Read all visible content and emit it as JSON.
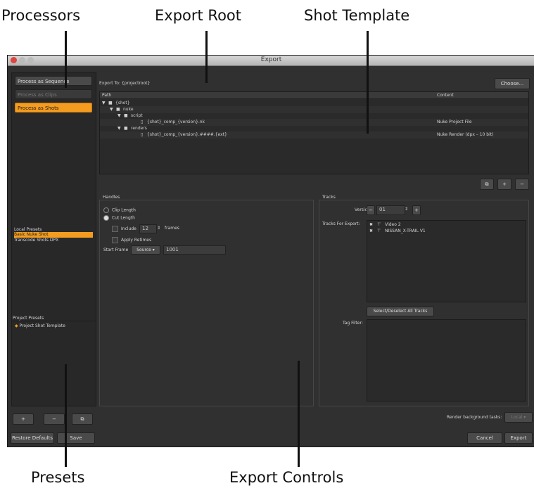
{
  "callouts": {
    "processors": "Processors",
    "export_root": "Export Root",
    "shot_template": "Shot Template",
    "presets": "Presets",
    "export_controls": "Export Controls"
  },
  "window": {
    "title": "Export"
  },
  "processors": {
    "items": [
      {
        "label": "Process as Sequence",
        "state": "normal"
      },
      {
        "label": "Process as Clips",
        "state": "disabled"
      },
      {
        "label": "Process as Shots",
        "state": "selected"
      }
    ]
  },
  "local_presets": {
    "heading": "Local Presets",
    "items": [
      "Basic Nuke Shot",
      "Transcode Shots DPX"
    ]
  },
  "project_presets": {
    "heading": "Project Presets",
    "items": [
      "Project Shot Template"
    ]
  },
  "left_buttons": {
    "add": "+",
    "remove": "−",
    "copy": "⧉",
    "restore": "Restore Defaults",
    "save": "Save"
  },
  "export_to": {
    "label": "Export To:",
    "value": "{projectroot}",
    "choose": "Choose..."
  },
  "shot_template": {
    "col_path": "Path",
    "col_content": "Content",
    "rows": [
      {
        "name": "{shot}",
        "content": ""
      },
      {
        "name": "nuke",
        "content": ""
      },
      {
        "name": "script",
        "content": ""
      },
      {
        "name": "{shot}_comp_{version}.nk",
        "content": "Nuke Project File"
      },
      {
        "name": "renders",
        "content": ""
      },
      {
        "name": "{shot}_comp_{version}.####.{ext}",
        "content": "Nuke Render (dpx – 10 bit)"
      }
    ],
    "buttons": {
      "folder": "⧉",
      "add": "+",
      "remove": "−"
    }
  },
  "handles": {
    "title": "Handles",
    "clip_length": "Clip Length",
    "cut_length": "Cut Length",
    "include": "Include",
    "include_value": "12",
    "frames": "frames",
    "apply_retimes": "Apply Retimes",
    "start_frame_label": "Start Frame",
    "start_frame_mode": "Source",
    "start_frame_value": "1001"
  },
  "tracks": {
    "title": "Tracks",
    "version_label": "Version:",
    "version_value": "01",
    "tracks_for_export_label": "Tracks For Export:",
    "tracks": [
      "Video 2",
      "NISSAN_X-TRAIL V1"
    ],
    "select_all": "Select/Deselect All Tracks",
    "tag_filter_label": "Tag Filter:"
  },
  "footer": {
    "render_bg_label": "Render background tasks:",
    "render_bg_value": "Local",
    "cancel": "Cancel",
    "export": "Export"
  }
}
